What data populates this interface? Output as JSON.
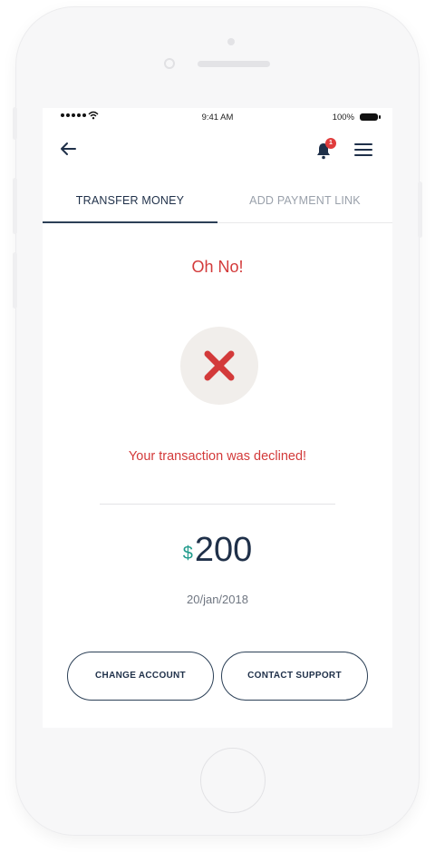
{
  "status_bar": {
    "time": "9:41 AM",
    "battery_percent": "100%",
    "signal_icon": "signal-dots-icon",
    "wifi_icon": "wifi-icon",
    "battery_icon": "battery-icon"
  },
  "header": {
    "back_icon": "arrow-left-icon",
    "notifications_icon": "bell-icon",
    "notification_count": "1",
    "menu_icon": "hamburger-menu-icon"
  },
  "tabs": [
    {
      "label": "TRANSFER MONEY",
      "active": true
    },
    {
      "label": "ADD PAYMENT LINK",
      "active": false
    }
  ],
  "result": {
    "title": "Oh No!",
    "status_icon": "close-x-icon",
    "message": "Your transaction was declined!",
    "currency_symbol": "$",
    "amount": "200",
    "date": "20/jan/2018"
  },
  "actions": {
    "change_account_label": "CHANGE ACCOUNT",
    "contact_support_label": "CONTACT SUPPORT"
  },
  "colors": {
    "error": "#d33a3a",
    "primary": "#1f3049",
    "accent": "#1f9a8b",
    "badge": "#e03c3c",
    "muted": "#9aa1ab"
  }
}
